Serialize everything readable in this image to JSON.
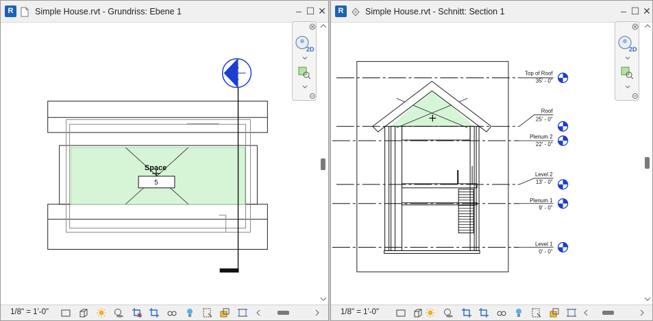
{
  "left_view": {
    "app_icon": "R",
    "title": "Simple House.rvt - Grundriss: Ebene 1",
    "window_controls": {
      "minimize": "–",
      "maximize": "☐",
      "close": "✕"
    },
    "room_label": "Space",
    "room_number": "5",
    "scale": "1/8\" = 1'-0\""
  },
  "right_view": {
    "app_icon": "R",
    "title": "Simple House.rvt - Schnitt: Section 1",
    "window_controls": {
      "minimize": "–",
      "maximize": "☐",
      "close": "✕"
    },
    "levels": [
      {
        "name": "Top of Roof",
        "elevation": "35' - 0\""
      },
      {
        "name": "Roof",
        "elevation": "25' - 0\""
      },
      {
        "name": "Plenum 2",
        "elevation": "22' - 0\""
      },
      {
        "name": "Level 2",
        "elevation": "13' - 0\""
      },
      {
        "name": "Plenum 1",
        "elevation": "9' - 0\""
      },
      {
        "name": "Level 1",
        "elevation": "0' - 0\""
      }
    ],
    "scale": "1/8\" = 1'-0\""
  },
  "icons": {
    "view_cube": "zoom-2d-navigation-icon",
    "zoom": "zoom-region-icon",
    "status": [
      "model-graphics-style-icon",
      "detail-level-icon",
      "sun-path-icon",
      "shadows-icon",
      "crop-view-icon",
      "show-crop-region-icon",
      "temporary-hide-icon",
      "reveal-hidden-icon",
      "analysis-display-icon",
      "highlight-displacement-icon",
      "worksharing-display-icon",
      "constraints-icon"
    ]
  },
  "colors": {
    "brand": "#1c62b9",
    "space_fill": "#d6f5d6",
    "elevation_marker": "#1c3fd1"
  }
}
